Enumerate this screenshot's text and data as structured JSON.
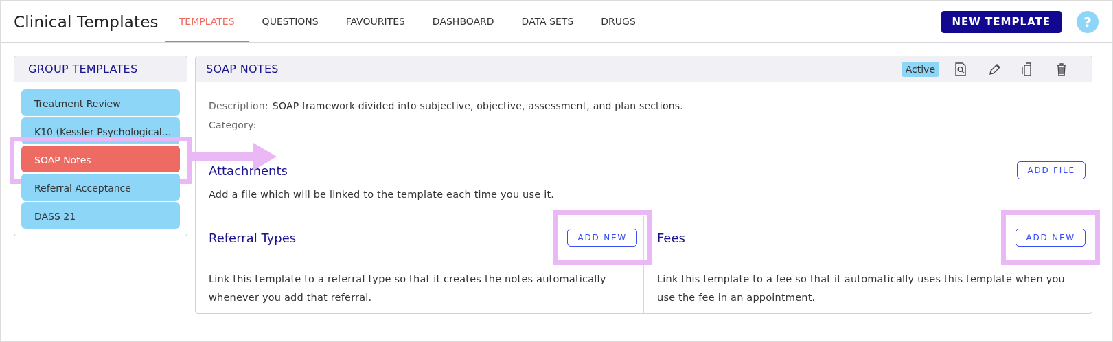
{
  "app": {
    "title": "Clinical Templates"
  },
  "tabs": [
    {
      "label": "TEMPLATES",
      "selected": true
    },
    {
      "label": "QUESTIONS",
      "selected": false
    },
    {
      "label": "FAVOURITES",
      "selected": false
    },
    {
      "label": "DASHBOARD",
      "selected": false
    },
    {
      "label": "DATA SETS",
      "selected": false
    },
    {
      "label": "DRUGS",
      "selected": false
    }
  ],
  "header_actions": {
    "new_template": "NEW TEMPLATE",
    "help": "?"
  },
  "sidebar": {
    "title": "GROUP TEMPLATES",
    "highlight_arrow": true,
    "items": [
      {
        "label": "Treatment Review",
        "selected": false,
        "highlighted": false
      },
      {
        "label": "K10 (Kessler Psychological…",
        "selected": false,
        "highlighted": false
      },
      {
        "label": "SOAP Notes",
        "selected": true,
        "highlighted": true
      },
      {
        "label": "Referral Acceptance",
        "selected": false,
        "highlighted": false
      },
      {
        "label": "DASS 21",
        "selected": false,
        "highlighted": false
      }
    ]
  },
  "template": {
    "title": "SOAP NOTES",
    "status": "Active",
    "fields": [
      {
        "label": "Description:",
        "value": "SOAP framework divided into subjective, objective, assessment, and plan sections."
      },
      {
        "label": "Category:"
      }
    ],
    "attachments": {
      "title": "Attachments",
      "text": "Add a file which will be linked to the template each time you use it.",
      "button": {
        "label": "ADD FILE"
      }
    },
    "sections": [
      {
        "title": "Referral Types",
        "text": "Link this template to a referral type so that it creates the notes automatically whenever you add that referral.",
        "button": {
          "label": "ADD NEW",
          "highlighted": true
        }
      },
      {
        "title": "Fees",
        "text": "Link this template to a fee so that it automatically uses this template when you use the fee in an appointment.",
        "button": {
          "label": "ADD NEW",
          "highlighted": true
        }
      }
    ]
  }
}
